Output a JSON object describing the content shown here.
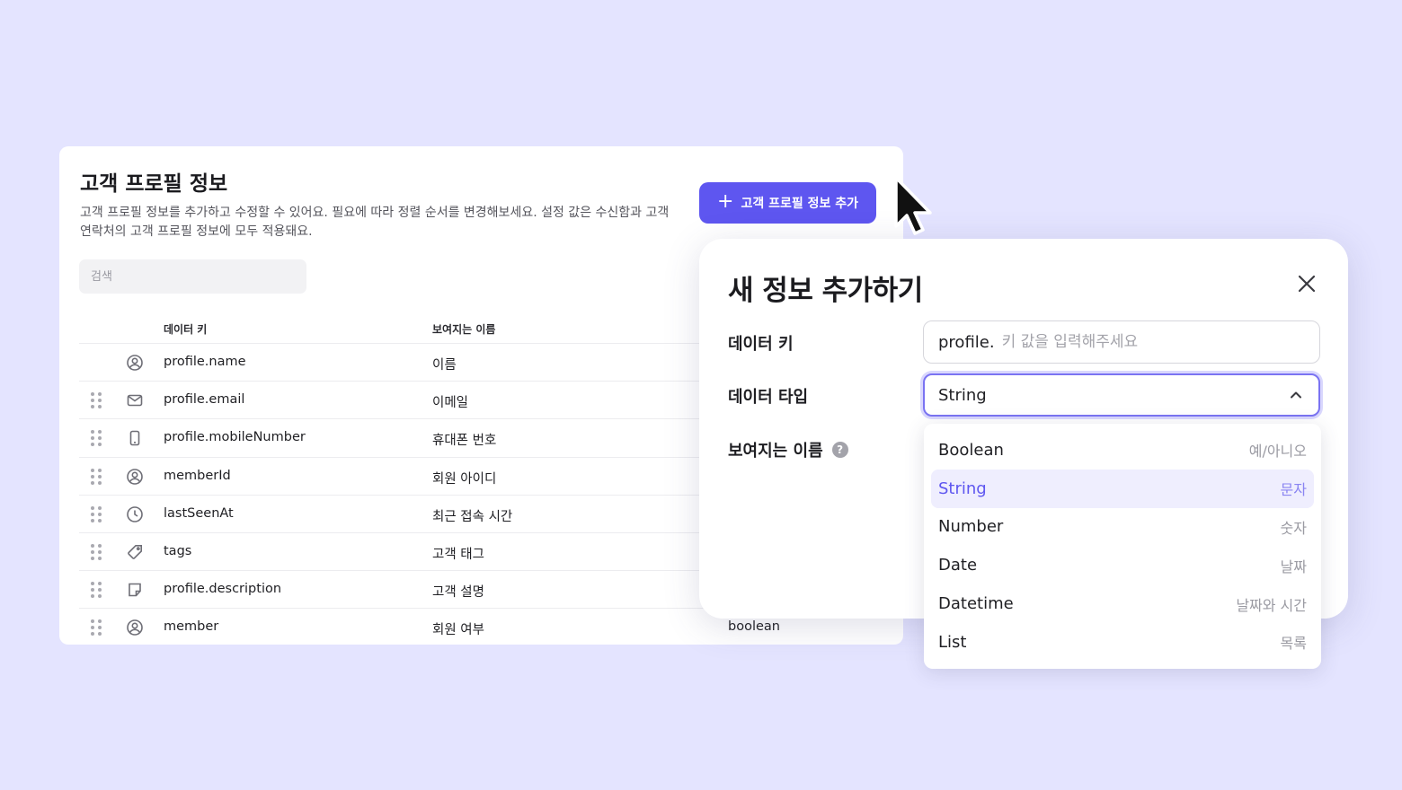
{
  "panel": {
    "title": "고객 프로필 정보",
    "description": "고객 프로필 정보를 추가하고 수정할 수 있어요. 필요에 따라 정렬 순서를 변경해보세요. 설정 값은 수신함과 고객 연락처의 고객 프로필 정보에 모두 적용돼요.",
    "add_button": "고객 프로필 정보 추가",
    "search_placeholder": "검색",
    "columns": {
      "key": "데이터 키",
      "name": "보여지는 이름"
    },
    "rows": [
      {
        "icon": "user-circle-icon",
        "key": "profile.name",
        "name": "이름",
        "type": ""
      },
      {
        "icon": "mail-icon",
        "key": "profile.email",
        "name": "이메일",
        "type": ""
      },
      {
        "icon": "mobile-icon",
        "key": "profile.mobileNumber",
        "name": "휴대폰 번호",
        "type": ""
      },
      {
        "icon": "user-circle-icon",
        "key": "memberId",
        "name": "회원 아이디",
        "type": ""
      },
      {
        "icon": "clock-icon",
        "key": "lastSeenAt",
        "name": "최근 접속 시간",
        "type": ""
      },
      {
        "icon": "tag-icon",
        "key": "tags",
        "name": "고객 태그",
        "type": ""
      },
      {
        "icon": "note-icon",
        "key": "profile.description",
        "name": "고객 설명",
        "type": ""
      },
      {
        "icon": "user-circle-icon",
        "key": "member",
        "name": "회원 여부",
        "type": "boolean"
      }
    ]
  },
  "dialog": {
    "title": "새 정보 추가하기",
    "data_key_label": "데이터 키",
    "data_key_prefix": "profile.",
    "data_key_placeholder": "키 값을 입력해주세요",
    "data_type_label": "데이터 타입",
    "data_type_value": "String",
    "display_name_label": "보여지는 이름",
    "help_glyph": "?"
  },
  "dropdown": {
    "options": [
      {
        "label": "Boolean",
        "desc": "예/아니오",
        "selected": false
      },
      {
        "label": "String",
        "desc": "문자",
        "selected": true
      },
      {
        "label": "Number",
        "desc": "숫자",
        "selected": false
      },
      {
        "label": "Date",
        "desc": "날짜",
        "selected": false
      },
      {
        "label": "Datetime",
        "desc": "날짜와 시간",
        "selected": false
      },
      {
        "label": "List",
        "desc": "목록",
        "selected": false
      }
    ]
  },
  "colors": {
    "background": "#e4e4ff",
    "accent": "#5e56f0",
    "selected_bg": "#efeefe"
  }
}
